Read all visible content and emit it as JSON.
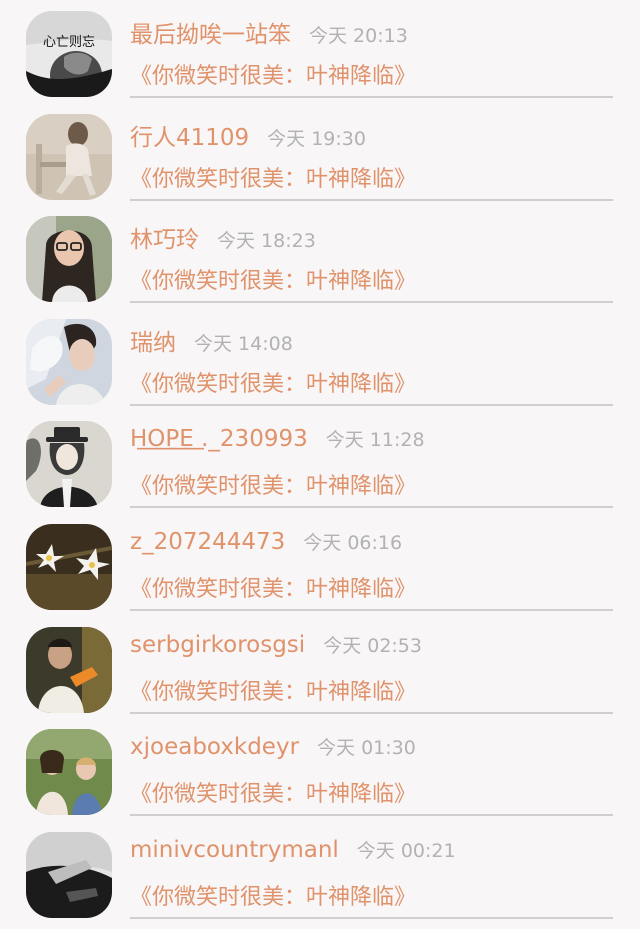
{
  "conversations": [
    {
      "name": "最后拗唉一站笨",
      "time": "今天 20:13",
      "message": "《你微笑时很美：叶神降临》",
      "avatar": "avatar-bw-portrait",
      "avatar_text": "心亡则忘"
    },
    {
      "name": "行人41109",
      "time": "今天 19:30",
      "message": "《你微笑时很美：叶神降临》",
      "avatar": "avatar-sepia-chair"
    },
    {
      "name": "林巧玲",
      "time": "今天 18:23",
      "message": "《你微笑时很美：叶神降临》",
      "avatar": "avatar-glasses-woman"
    },
    {
      "name": "瑞纳",
      "time": "今天 14:08",
      "message": "《你微笑时很美：叶神降临》",
      "avatar": "avatar-feather-man"
    },
    {
      "name": "H͟O͟P͟E͟ ._230993",
      "time": "今天 11:28",
      "message": "《你微笑时很美：叶神降临》",
      "avatar": "avatar-anime-detective"
    },
    {
      "name": "z_207244473",
      "time": "今天 06:16",
      "message": "《你微笑时很美：叶神降临》",
      "avatar": "avatar-white-flowers"
    },
    {
      "name": "serbgirkorosgsi",
      "time": "今天 02:53",
      "message": "《你微笑时很美：叶神降临》",
      "avatar": "avatar-orange-man"
    },
    {
      "name": "xjoeaboxkdeyr",
      "time": "今天 01:30",
      "message": "《你微笑时很美：叶神降临》",
      "avatar": "avatar-two-children"
    },
    {
      "name": "minivcountrymanl",
      "time": "今天 00:21",
      "message": "《你微笑时很美：叶神降临》",
      "avatar": "avatar-dark-hand"
    }
  ],
  "colors": {
    "accent": "#e0936b",
    "time": "#b2b2b2",
    "divider": "#cfcfcf",
    "background": "#f8f6f7"
  }
}
